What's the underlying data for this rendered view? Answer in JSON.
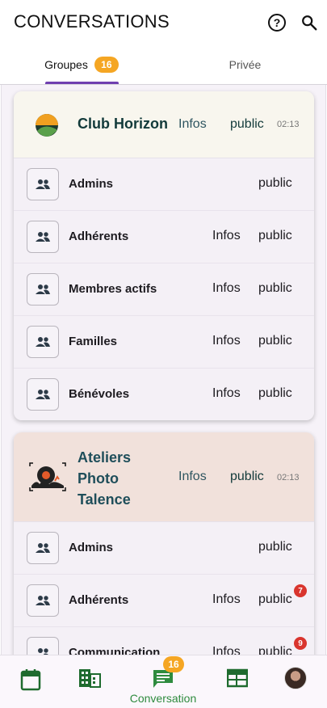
{
  "header": {
    "title": "CONVERSATIONS",
    "help_icon": "help-circle-icon",
    "search_icon": "search-icon"
  },
  "tabs": [
    {
      "label": "Groupes",
      "badge": "16",
      "active": true
    },
    {
      "label": "Privée",
      "active": false
    }
  ],
  "accent": {
    "tab_indicator": "#6f3fb0",
    "badge": "#f5a623",
    "nav_active": "#2e8b3e",
    "notification": "#d9352e"
  },
  "groups": [
    {
      "name": "Club Horizon",
      "infos_label": "Infos",
      "visibility": "public",
      "time": "02:13",
      "rows": [
        {
          "name": "Admins",
          "infos_label": "",
          "visibility": "public",
          "badge": ""
        },
        {
          "name": "Adhérents",
          "infos_label": "Infos",
          "visibility": "public",
          "badge": ""
        },
        {
          "name": "Membres actifs",
          "infos_label": "Infos",
          "visibility": "public",
          "badge": ""
        },
        {
          "name": "Familles",
          "infos_label": "Infos",
          "visibility": "public",
          "badge": ""
        },
        {
          "name": "Bénévoles",
          "infos_label": "Infos",
          "visibility": "public",
          "badge": ""
        }
      ]
    },
    {
      "name": "Ateliers Photo Talence",
      "infos_label": "Infos",
      "visibility": "public",
      "time": "02:13",
      "rows": [
        {
          "name": "Admins",
          "infos_label": "",
          "visibility": "public",
          "badge": ""
        },
        {
          "name": "Adhérents",
          "infos_label": "Infos",
          "visibility": "public",
          "badge": "7"
        },
        {
          "name": "Communication",
          "infos_label": "Infos",
          "visibility": "public",
          "badge": "9"
        }
      ]
    }
  ],
  "bottom_nav": {
    "items": [
      {
        "icon": "calendar-icon",
        "label": ""
      },
      {
        "icon": "building-icon",
        "label": ""
      },
      {
        "icon": "chat-icon",
        "label": "Conversation",
        "badge": "16",
        "active": true
      },
      {
        "icon": "newspaper-icon",
        "label": ""
      },
      {
        "icon": "avatar",
        "label": ""
      }
    ]
  }
}
